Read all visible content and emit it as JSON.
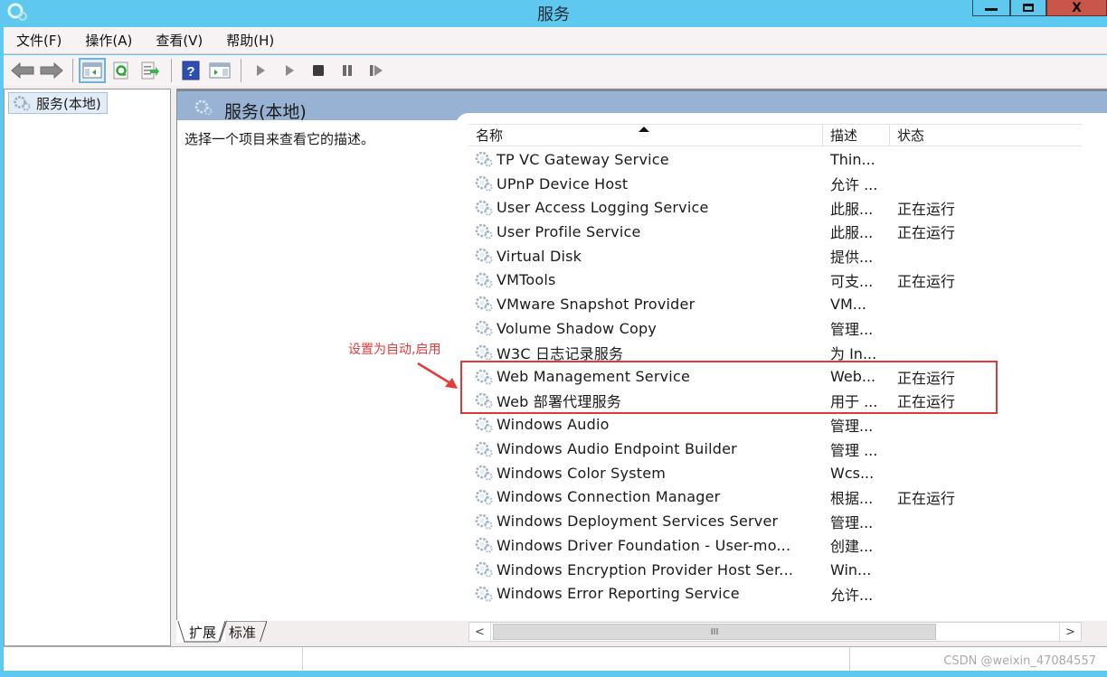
{
  "window": {
    "title": "服务",
    "controls": {
      "minimize": "—",
      "maximize": "▭",
      "close": "X"
    }
  },
  "menu": [
    {
      "label": "文件(F)"
    },
    {
      "label": "操作(A)"
    },
    {
      "label": "查看(V)"
    },
    {
      "label": "帮助(H)"
    }
  ],
  "toolbar": {
    "buttons": [
      {
        "icon": "back-arrow-icon"
      },
      {
        "icon": "forward-arrow-icon"
      },
      {
        "icon": "show-hide-console-tree-icon",
        "active": true
      },
      {
        "icon": "refresh-icon"
      },
      {
        "icon": "export-list-icon"
      },
      {
        "icon": "help-icon"
      },
      {
        "icon": "show-action-pane-icon"
      },
      {
        "icon": "start-service-icon"
      },
      {
        "icon": "start-service-alt-icon"
      },
      {
        "icon": "stop-service-icon"
      },
      {
        "icon": "pause-service-icon"
      },
      {
        "icon": "resume-service-icon"
      }
    ]
  },
  "tree": {
    "selected_item": "服务(本地)"
  },
  "content": {
    "header_title": "服务(本地)",
    "description_hint": "选择一个项目来查看它的描述。",
    "columns": {
      "name": "名称",
      "description": "描述",
      "status": "状态"
    },
    "sort_column": "名称",
    "services": [
      {
        "name": "TP VC Gateway Service",
        "description": "Thin...",
        "status": ""
      },
      {
        "name": "UPnP Device Host",
        "description": "允许 ...",
        "status": ""
      },
      {
        "name": "User Access Logging Service",
        "description": "此服...",
        "status": "正在运行"
      },
      {
        "name": "User Profile Service",
        "description": "此服...",
        "status": "正在运行"
      },
      {
        "name": "Virtual Disk",
        "description": "提供...",
        "status": ""
      },
      {
        "name": "VMTools",
        "description": "可支...",
        "status": "正在运行"
      },
      {
        "name": "VMware Snapshot Provider",
        "description": "VM...",
        "status": ""
      },
      {
        "name": "Volume Shadow Copy",
        "description": "管理...",
        "status": ""
      },
      {
        "name": "W3C 日志记录服务",
        "description": "为 In...",
        "status": ""
      },
      {
        "name": "Web Management Service",
        "description": "Web...",
        "status": "正在运行"
      },
      {
        "name": "Web 部署代理服务",
        "description": "用于 ...",
        "status": "正在运行"
      },
      {
        "name": "Windows Audio",
        "description": "管理...",
        "status": ""
      },
      {
        "name": "Windows Audio Endpoint Builder",
        "description": "管理 ...",
        "status": ""
      },
      {
        "name": "Windows Color System",
        "description": "Wcs...",
        "status": ""
      },
      {
        "name": "Windows Connection Manager",
        "description": "根据...",
        "status": "正在运行"
      },
      {
        "name": "Windows Deployment Services Server",
        "description": "管理...",
        "status": ""
      },
      {
        "name": "Windows Driver Foundation - User-mo...",
        "description": "创建...",
        "status": ""
      },
      {
        "name": "Windows Encryption Provider Host Ser...",
        "description": "Win...",
        "status": ""
      },
      {
        "name": "Windows Error Reporting Service",
        "description": "允许...",
        "status": ""
      }
    ],
    "tabs": [
      {
        "label": "扩展",
        "active": true
      },
      {
        "label": "标准",
        "active": false
      }
    ]
  },
  "annotation": {
    "text": "设置为自动,启用",
    "color": "#e23b3b",
    "highlighted_services": [
      "Web Management Service",
      "Web 部署代理服务"
    ]
  },
  "statusbar": {
    "watermark": "CSDN @weixin_47084557"
  },
  "colors": {
    "titlebar": "#5ec8ee",
    "close_button": "#c8574a",
    "content_header": "#97b2d2",
    "annotation": "#d93a3a"
  }
}
